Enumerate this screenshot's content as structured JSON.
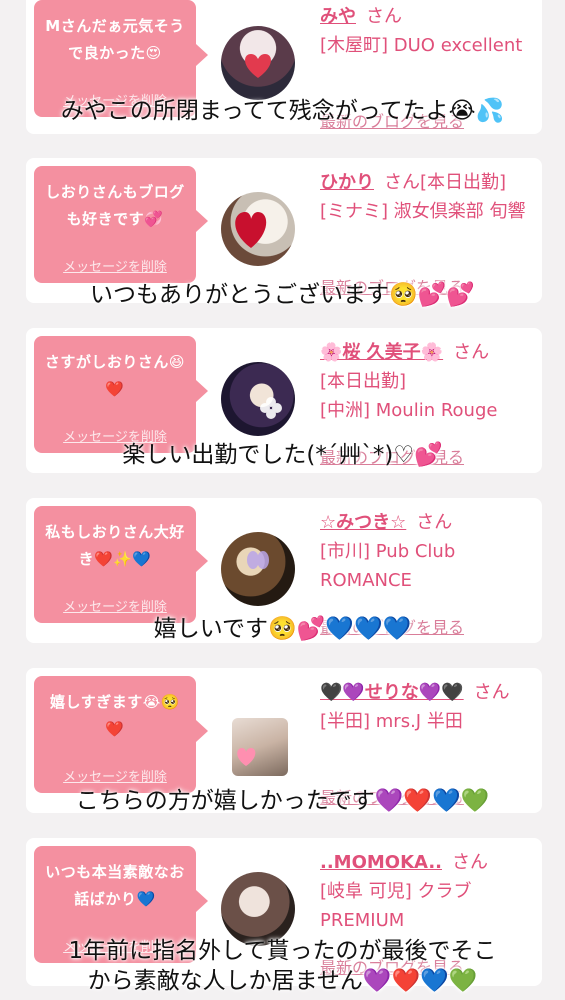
{
  "delete_label": "メッセージを削除",
  "blog_label": "最新のブログを見る",
  "cards": [
    {
      "message": "Mさんだぁ元気そうで良かった😍",
      "girl_name": "みや",
      "honorific": "さん",
      "badge": "",
      "area_line": "[木屋町] DUO excellent",
      "caption": "みやこの所閉まってて残念がってたよ😭💦"
    },
    {
      "message": "しおりさんもブログも好きです💞",
      "girl_name": "ひかり",
      "honorific": "さん",
      "badge": "[本日出勤]",
      "area_line": "[ミナミ] 淑女倶楽部 旬響",
      "caption": "いつもありがとうございます🥺💕💕"
    },
    {
      "message": "さすがしおりさん😆❤️",
      "girl_name": "🌸桜 久美子🌸",
      "honorific": "さん",
      "badge": "[本日出勤]",
      "area_line": "[中洲] Moulin Rouge",
      "caption": "楽しい出勤でした(*´艸`*)♡💕"
    },
    {
      "message": "私もしおりさん大好き❤️✨💙",
      "girl_name": "☆みつき☆",
      "honorific": "さん",
      "badge": "",
      "area_line": "[市川] Pub Club ROMANCE",
      "caption": "嬉しいです🥺💕💙💙💙"
    },
    {
      "message": "嬉しすぎます😭🥺❤️",
      "girl_name": "🖤💜せりな💜🖤",
      "honorific": "さん",
      "badge": "",
      "area_line": "[半田] mrs.J 半田",
      "caption": "こちらの方が嬉しかったです💜❤️💙💚"
    },
    {
      "message": "いつも本当素敵なお話ばかり💙",
      "girl_name": "..MOMOKA..",
      "honorific": "さん",
      "badge": "",
      "area_line": "[岐阜 可児] クラブ PREMIUM",
      "caption_line1": "1年前に指名外して貰ったのが最後でそこ",
      "caption_line2": "から素敵な人しか居ません💜❤️💙💚"
    }
  ]
}
